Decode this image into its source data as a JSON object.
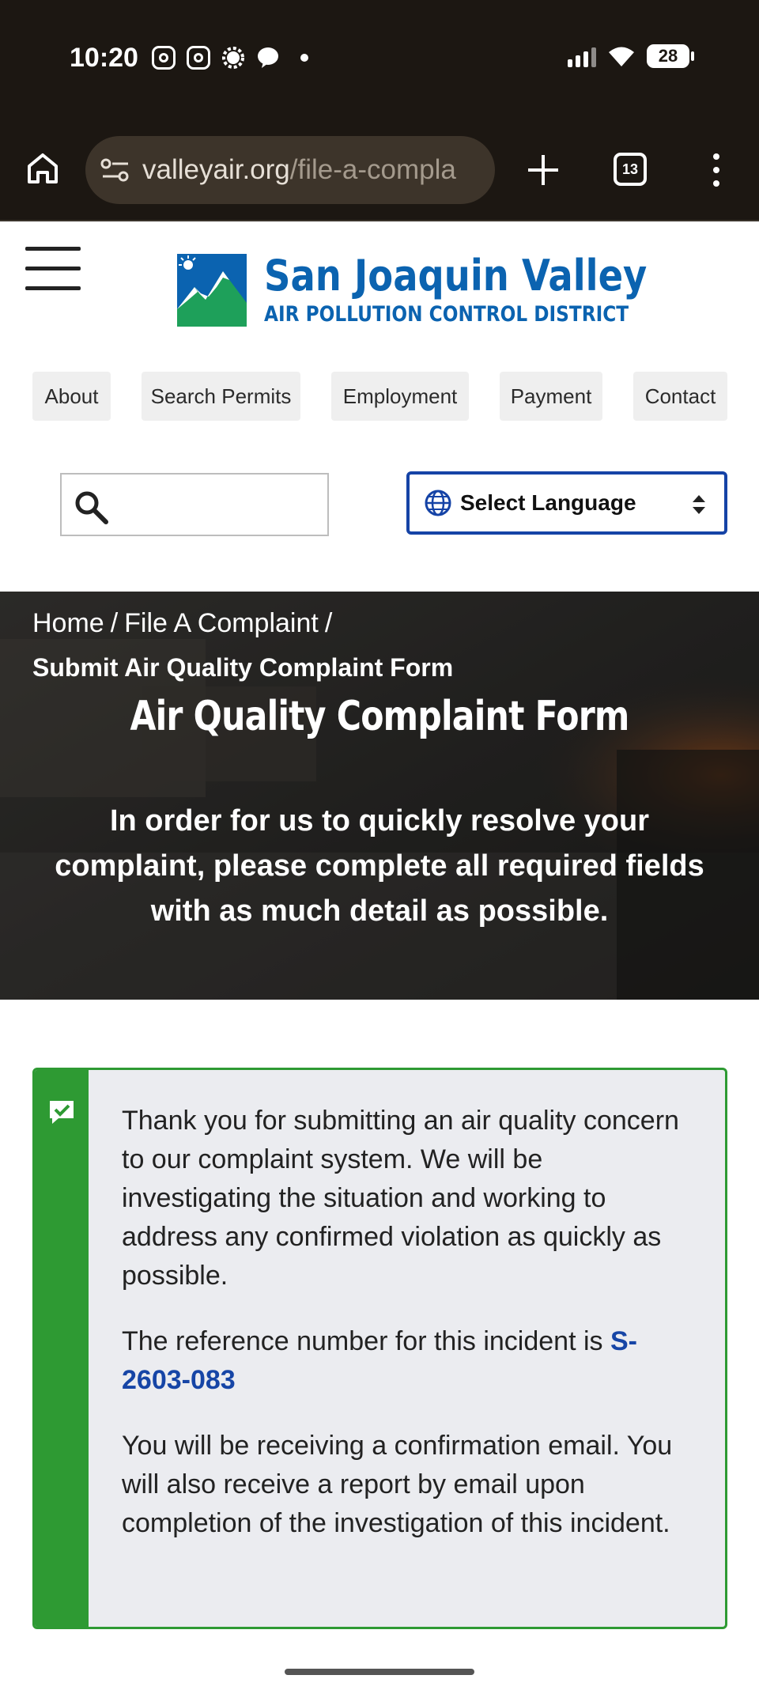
{
  "status_bar": {
    "time": "10:20",
    "battery": "28",
    "icons": [
      "instagram-icon",
      "instagram-icon",
      "signal-app-icon",
      "chat-bubble-icon",
      "notification-dot-icon",
      "cell-signal-icon",
      "wifi-icon",
      "battery-icon"
    ]
  },
  "browser": {
    "url_host": "valleyair.org",
    "url_path": "/file-a-compla",
    "tab_count": "13",
    "icons": [
      "home-icon",
      "site-settings-icon",
      "new-tab-plus-icon",
      "tabs-icon",
      "overflow-menu-icon"
    ]
  },
  "site": {
    "logo_title": "San Joaquin Valley",
    "logo_subtitle": "AIR POLLUTION CONTROL DISTRICT",
    "brand_color": "#0b63b0",
    "nav": [
      "About",
      "Search Permits",
      "Employment",
      "Payment",
      "Contact"
    ],
    "search_placeholder": "",
    "language_label": "Select Language"
  },
  "hero": {
    "breadcrumb": [
      "Home",
      "File A Complaint"
    ],
    "breadcrumb_separator": "/",
    "breadcrumb_current": "Submit Air Quality Complaint Form",
    "title": "Air Quality Complaint Form",
    "intro": "In order for us to quickly resolve your complaint, please complete all required fields with as much detail as possible."
  },
  "confirmation": {
    "accent_color": "#2e9a33",
    "paragraph1": "Thank you for submitting an air quality concern to our complaint system. We will be investigating the situation and working to address any confirmed violation as quickly as possible.",
    "paragraph2_prefix": "The reference number for this incident is ",
    "reference_number": "S-2603-083",
    "paragraph3": "You will be receiving a confirmation email. You will also receive a report by email upon completion of the investigation of this incident."
  }
}
